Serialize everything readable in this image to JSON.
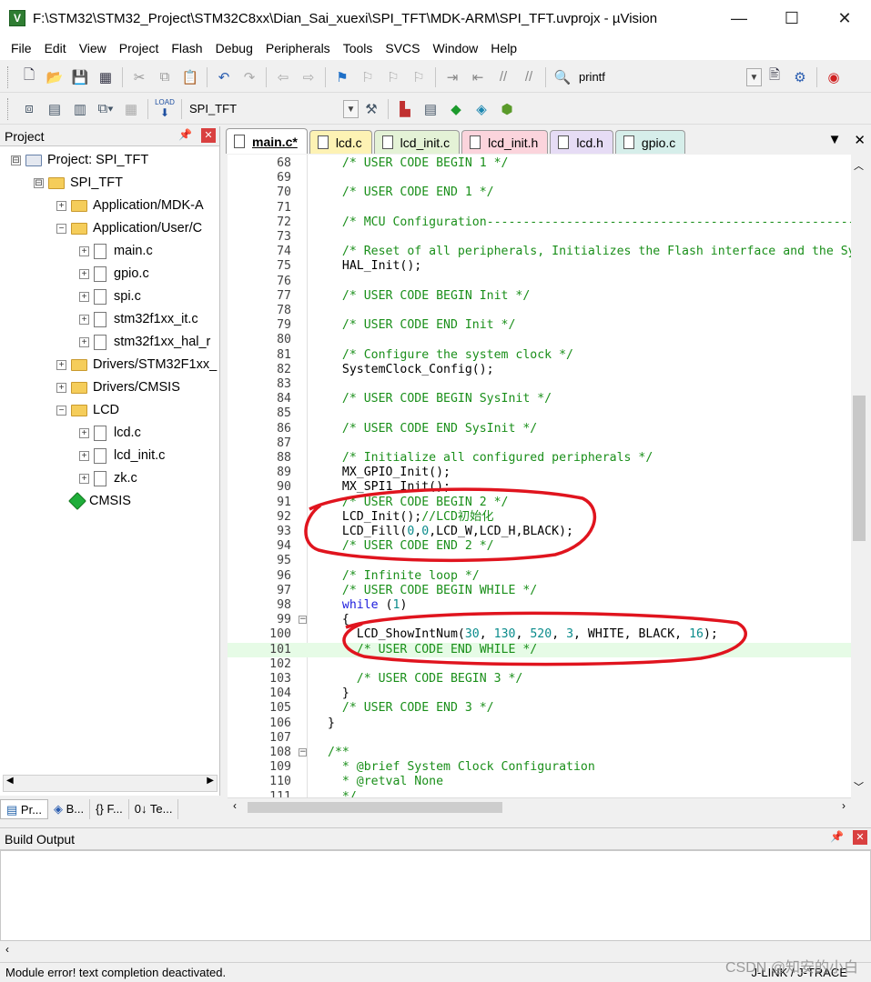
{
  "window": {
    "title": "F:\\STM32\\STM32_Project\\STM32C8xx\\Dian_Sai_xuexi\\SPI_TFT\\MDK-ARM\\SPI_TFT.uvprojx - µVision",
    "minimize": "—",
    "maximize": "☐",
    "close": "✕"
  },
  "menu": [
    "File",
    "Edit",
    "View",
    "Project",
    "Flash",
    "Debug",
    "Peripherals",
    "Tools",
    "SVCS",
    "Window",
    "Help"
  ],
  "toolbar": {
    "find_combo_value": "printf",
    "target_combo_value": "SPI_TFT",
    "load_label": "LOAD"
  },
  "project_panel": {
    "title": "Project",
    "tree": [
      {
        "label": "Project: SPI_TFT",
        "kind": "project",
        "level": 0,
        "box": "⊟"
      },
      {
        "label": "SPI_TFT",
        "kind": "folder",
        "level": 1,
        "box": "⊟"
      },
      {
        "label": "Application/MDK-A",
        "kind": "folder",
        "level": 2,
        "box": "+"
      },
      {
        "label": "Application/User/C",
        "kind": "folder",
        "level": 2,
        "box": "−"
      },
      {
        "label": "main.c",
        "kind": "file",
        "level": 3,
        "box": "+"
      },
      {
        "label": "gpio.c",
        "kind": "file",
        "level": 3,
        "box": "+"
      },
      {
        "label": "spi.c",
        "kind": "file",
        "level": 3,
        "box": "+"
      },
      {
        "label": "stm32f1xx_it.c",
        "kind": "file",
        "level": 3,
        "box": "+"
      },
      {
        "label": "stm32f1xx_hal_r",
        "kind": "file",
        "level": 3,
        "box": "+"
      },
      {
        "label": "Drivers/STM32F1xx_",
        "kind": "folder",
        "level": 2,
        "box": "+"
      },
      {
        "label": "Drivers/CMSIS",
        "kind": "folder",
        "level": 2,
        "box": "+"
      },
      {
        "label": "LCD",
        "kind": "folder",
        "level": 2,
        "box": "−"
      },
      {
        "label": "lcd.c",
        "kind": "file",
        "level": 3,
        "box": "+"
      },
      {
        "label": "lcd_init.c",
        "kind": "file",
        "level": 3,
        "box": "+"
      },
      {
        "label": "zk.c",
        "kind": "file",
        "level": 3,
        "box": "+"
      },
      {
        "label": "CMSIS",
        "kind": "component",
        "level": 2,
        "box": ""
      }
    ],
    "tabs": [
      "Pr...",
      "B...",
      "{} F...",
      "0↓ Te..."
    ]
  },
  "editor": {
    "tabs": [
      {
        "label": "main.c*",
        "color": "#ffffff",
        "active": true
      },
      {
        "label": "lcd.c",
        "color": "#fdf2b4",
        "active": false
      },
      {
        "label": "lcd_init.c",
        "color": "#e4f2d6",
        "active": false
      },
      {
        "label": "lcd_init.h",
        "color": "#fbd4dc",
        "active": false
      },
      {
        "label": "lcd.h",
        "color": "#e6dcf5",
        "active": false
      },
      {
        "label": "gpio.c",
        "color": "#d6eeea",
        "active": false
      }
    ],
    "lines": [
      {
        "n": "68",
        "t": "  /* USER CODE BEGIN 1 */",
        "c": "cm"
      },
      {
        "n": "69",
        "t": "",
        "c": ""
      },
      {
        "n": "70",
        "t": "  /* USER CODE END 1 */",
        "c": "cm"
      },
      {
        "n": "71",
        "t": "",
        "c": ""
      },
      {
        "n": "72",
        "t": "  /* MCU Configuration--------------------------------------------------------",
        "c": "cm"
      },
      {
        "n": "73",
        "t": "",
        "c": ""
      },
      {
        "n": "74",
        "t": "  /* Reset of all peripherals, Initializes the Flash interface and the Systick. */",
        "c": "cm"
      },
      {
        "n": "75",
        "t": "  HAL_Init();",
        "c": ""
      },
      {
        "n": "76",
        "t": "",
        "c": ""
      },
      {
        "n": "77",
        "t": "  /* USER CODE BEGIN Init */",
        "c": "cm"
      },
      {
        "n": "78",
        "t": "",
        "c": ""
      },
      {
        "n": "79",
        "t": "  /* USER CODE END Init */",
        "c": "cm"
      },
      {
        "n": "80",
        "t": "",
        "c": ""
      },
      {
        "n": "81",
        "t": "  /* Configure the system clock */",
        "c": "cm"
      },
      {
        "n": "82",
        "t": "  SystemClock_Config();",
        "c": ""
      },
      {
        "n": "83",
        "t": "",
        "c": ""
      },
      {
        "n": "84",
        "t": "  /* USER CODE BEGIN SysInit */",
        "c": "cm"
      },
      {
        "n": "85",
        "t": "",
        "c": ""
      },
      {
        "n": "86",
        "t": "  /* USER CODE END SysInit */",
        "c": "cm"
      },
      {
        "n": "87",
        "t": "",
        "c": ""
      },
      {
        "n": "88",
        "t": "  /* Initialize all configured peripherals */",
        "c": "cm"
      },
      {
        "n": "89",
        "t": "  MX_GPIO_Init();",
        "c": ""
      },
      {
        "n": "90",
        "t": "  MX_SPI1_Init();",
        "c": ""
      },
      {
        "n": "91",
        "t": "  /* USER CODE BEGIN 2 */",
        "c": "cm"
      },
      {
        "n": "92",
        "t": "  LCD_Init();//LCD初始化",
        "c": "mix1"
      },
      {
        "n": "93",
        "t": "  LCD_Fill(0,0,LCD_W,LCD_H,BLACK);",
        "c": "mix2"
      },
      {
        "n": "94",
        "t": "  /* USER CODE END 2 */",
        "c": "cm"
      },
      {
        "n": "95",
        "t": "",
        "c": ""
      },
      {
        "n": "96",
        "t": "  /* Infinite loop */",
        "c": "cm"
      },
      {
        "n": "97",
        "t": "  /* USER CODE BEGIN WHILE */",
        "c": "cm"
      },
      {
        "n": "98",
        "t": "  while (1)",
        "c": "mix3"
      },
      {
        "n": "99",
        "t": "  {",
        "c": ""
      },
      {
        "n": "100",
        "t": "    LCD_ShowIntNum(30, 130, 520, 3, WHITE, BLACK, 16);",
        "c": "mix4"
      },
      {
        "n": "101",
        "t": "    /* USER CODE END WHILE */",
        "c": "cm"
      },
      {
        "n": "102",
        "t": "",
        "c": ""
      },
      {
        "n": "103",
        "t": "    /* USER CODE BEGIN 3 */",
        "c": "cm"
      },
      {
        "n": "104",
        "t": "  }",
        "c": ""
      },
      {
        "n": "105",
        "t": "  /* USER CODE END 3 */",
        "c": "cm"
      },
      {
        "n": "106",
        "t": "}",
        "c": ""
      },
      {
        "n": "107",
        "t": "",
        "c": ""
      },
      {
        "n": "108",
        "t": "/**",
        "c": "cm"
      },
      {
        "n": "109",
        "t": "  * @brief System Clock Configuration",
        "c": "cm"
      },
      {
        "n": "110",
        "t": "  * @retval None",
        "c": "cm"
      },
      {
        "n": "111",
        "t": "  */",
        "c": "cm"
      }
    ],
    "highlight_line": "101"
  },
  "build_output": {
    "title": "Build Output"
  },
  "status": {
    "message": "Module error! text completion deactivated.",
    "debugger": "J-LINK / J-TRACE",
    "watermark": "CSDN @知安的小白"
  },
  "colors": {
    "comment": "#1a8f1a",
    "keyword": "#1d1ddd",
    "number": "#0b8c8c",
    "annotation": "#e0141e",
    "highlight": "#e6fbe6"
  }
}
